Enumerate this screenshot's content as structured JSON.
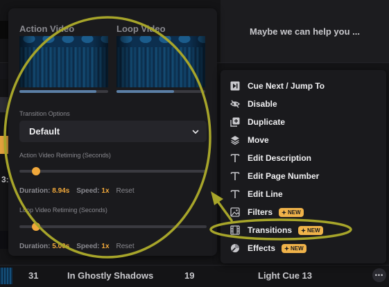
{
  "background": {
    "header_right_text": "Maybe we can help you ...",
    "bottom_row": {
      "number": "31",
      "title": "In Ghostly Shadows",
      "page": "19",
      "cue": "Light Cue 13",
      "more_label": "•••"
    },
    "side_fragments": [
      "3:"
    ]
  },
  "popover": {
    "action_video_label": "Action Video",
    "loop_video_label": "Loop Video",
    "action_video_progress": 0.87,
    "loop_video_progress": 0.65,
    "transition_options_label": "Transition Options",
    "transition_select_value": "Default",
    "action_retiming_label": "Action Video Retiming (Seconds)",
    "action_slider_value": 0.09,
    "action_duration_label": "Duration:",
    "action_duration_value": "8.94s",
    "action_speed_label": "Speed:",
    "action_speed_value": "1x",
    "action_reset_label": "Reset",
    "loop_retiming_label": "Loop Video Retiming (Seconds)",
    "loop_slider_value": 0.09,
    "loop_duration_label": "Duration:",
    "loop_duration_value": "5.00s",
    "loop_speed_label": "Speed:",
    "loop_speed_value": "1x",
    "loop_reset_label": "Reset"
  },
  "menu": {
    "items": [
      {
        "label": "Cue Next / Jump To",
        "icon": "skip-next-icon"
      },
      {
        "label": "Disable",
        "icon": "eye-off-icon"
      },
      {
        "label": "Duplicate",
        "icon": "duplicate-icon"
      },
      {
        "label": "Move",
        "icon": "layers-icon"
      },
      {
        "label": "Edit Description",
        "icon": "text-icon"
      },
      {
        "label": "Edit Page Number",
        "icon": "text-icon"
      },
      {
        "label": "Edit Line",
        "icon": "text-icon"
      },
      {
        "label": "Filters",
        "icon": "image-icon",
        "badge": "NEW"
      },
      {
        "label": "Transitions",
        "icon": "film-icon",
        "badge": "NEW"
      },
      {
        "label": "Effects",
        "icon": "effects-icon",
        "badge": "NEW"
      }
    ]
  },
  "colors": {
    "accent": "#f0a83b",
    "badge": "#f0b34a",
    "annotation": "#a7a52a",
    "progress": "#5b7fa6"
  }
}
